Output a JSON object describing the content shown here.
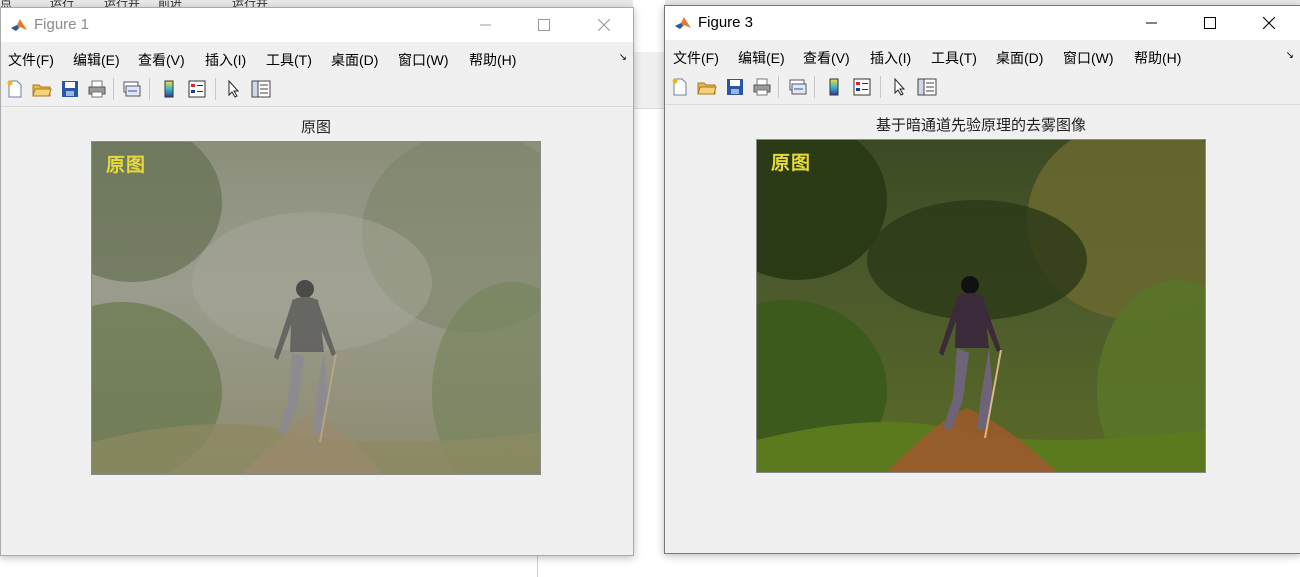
{
  "background": {
    "tab1": "点",
    "tab2": "运行",
    "tab3": "运行并",
    "tab4": "前进",
    "tab5": "运行并"
  },
  "menus": [
    "文件(F)",
    "编辑(E)",
    "查看(V)",
    "插入(I)",
    "工具(T)",
    "桌面(D)",
    "窗口(W)",
    "帮助(H)"
  ],
  "toolbar_icons": [
    "new-figure-icon",
    "open-file-icon",
    "save-icon",
    "print-icon",
    "link-plot-icon",
    "insert-colorbar-icon",
    "insert-legend-icon",
    "select-arrow-icon",
    "property-inspector-icon"
  ],
  "figure1": {
    "title": "Figure 1",
    "axes_title": "原图",
    "image_label": "原图"
  },
  "figure3": {
    "title": "Figure 3",
    "axes_title": "基于暗通道先验原理的去雾图像",
    "image_label": "原图"
  },
  "colors": {
    "window_bg": "#f0f0f0",
    "image_label": "#e6d93a",
    "matlab_orange": "#e8762d",
    "matlab_blue": "#1f5fa8"
  }
}
